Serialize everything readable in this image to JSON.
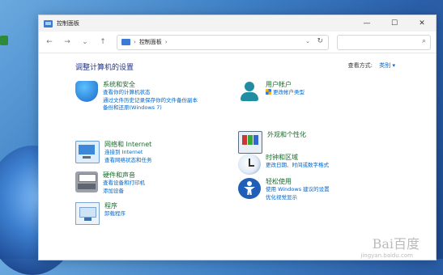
{
  "window": {
    "title": "控制面板"
  },
  "nav": {
    "back": "←",
    "forward": "→",
    "down": "⌄",
    "up": "↑"
  },
  "address": {
    "path": "控制面板",
    "sep": "›"
  },
  "main": {
    "heading": "调整计算机的设置",
    "view_by_label": "查看方式:",
    "view_by_value": "类别 ▾"
  },
  "categories": [
    {
      "title": "系统和安全",
      "icon": "shield-icon",
      "links": [
        "查看你的计算机状态",
        "通过文件历史记录保存你的文件备份副本",
        "备份和还原(Windows 7)"
      ]
    },
    {
      "title": "网络和 Internet",
      "icon": "network-icon",
      "links": [
        "连接到 Internet",
        "查看网络状态和任务"
      ]
    },
    {
      "title": "硬件和声音",
      "icon": "printer-icon",
      "links": [
        "查看设备和打印机",
        "添加设备"
      ]
    },
    {
      "title": "程序",
      "icon": "programs-icon",
      "links": [
        "卸载程序"
      ]
    },
    {
      "title": "用户帐户",
      "icon": "user-icon",
      "links": [
        "更改帐户类型"
      ]
    },
    {
      "title": "外观和个性化",
      "icon": "appearance-icon",
      "links": []
    },
    {
      "title": "时钟和区域",
      "icon": "clock-icon",
      "links": [
        "更改日期、时间或数字格式"
      ]
    },
    {
      "title": "轻松使用",
      "icon": "accessibility-icon",
      "links": [
        "使用 Windows 建议的设置",
        "优化视觉显示"
      ]
    }
  ],
  "watermark": {
    "main": "Bai百度",
    "sub": "jingyan.baidu.com"
  }
}
